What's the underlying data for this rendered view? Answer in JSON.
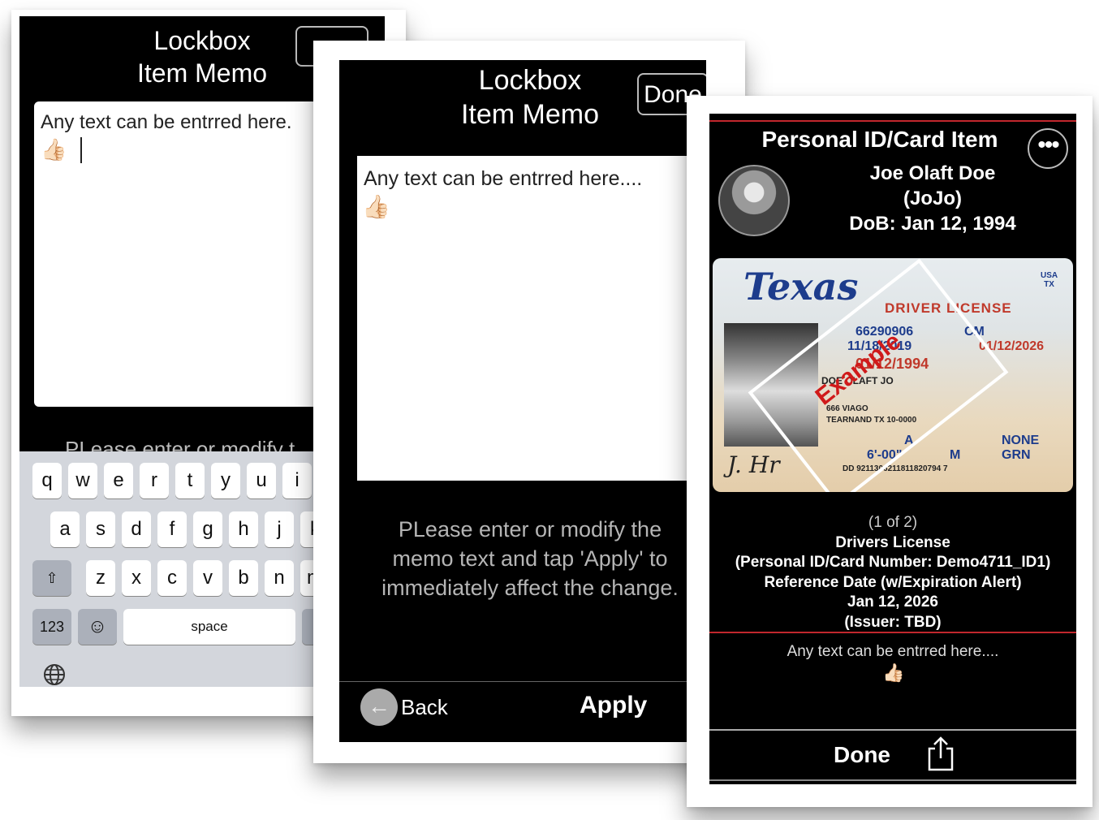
{
  "screen1": {
    "title_line1": "Lockbox",
    "title_line2": "Item Memo",
    "memo_text": "Any text can be entrred here.",
    "memo_emoji": "👍🏻",
    "hint_partial": "PLease enter or modify t",
    "keyboard": {
      "row1": [
        "q",
        "w",
        "e",
        "r",
        "t",
        "y",
        "u",
        "i"
      ],
      "row2": [
        "a",
        "s",
        "d",
        "f",
        "g",
        "h",
        "j",
        "k"
      ],
      "row3": [
        "z",
        "x",
        "c",
        "v",
        "b",
        "n",
        "m"
      ],
      "numbers_key": "123",
      "emoji_key": "☺",
      "space_key": "space",
      "shift_icon": "shift-icon",
      "globe_icon": "globe-icon"
    }
  },
  "screen2": {
    "title_line1": "Lockbox",
    "title_line2": "Item Memo",
    "done_label": "Done",
    "memo_text": "Any text can be entrred here....",
    "memo_emoji": "👍🏻",
    "hint": "PLease enter or modify the memo text and tap 'Apply' to immediately affect the change.",
    "back_label": "Back",
    "apply_label": "Apply"
  },
  "screen3": {
    "header_title": "Personal ID/Card  Item",
    "more_icon": "•••",
    "name": "Joe Olaft Doe",
    "nickname": "(JoJo)",
    "dob": "DoB: Jan 12, 1994",
    "id_card": {
      "state": "Texas",
      "country_line1": "USA",
      "country_line2": "TX",
      "title": "DRIVER LICENSE",
      "dl_number": "66290906",
      "iss": "11/18/2019",
      "exp": "01/12/2026",
      "dob": "01/12/1994",
      "class": "CM",
      "name": "DOE OLAFT JO",
      "address1": "666 VIAGO",
      "address2": "TEARNAND TX 10-0000",
      "restrictions": "A",
      "end": "NONE",
      "height": "6'-00\"",
      "sex": "M",
      "eyes": "GRN",
      "dd": "DD 9211306211811820794 7",
      "watermark": "Example",
      "signature": "J. Hr"
    },
    "count": "(1 of 2)",
    "card_type": "Drivers License",
    "card_number_line": "(Personal ID/Card Number: Demo4711_ID1)",
    "reference_label": "Reference Date (w/Expiration Alert)",
    "reference_date": "Jan 12, 2026",
    "issuer": "(Issuer: TBD)",
    "memo_text": "Any text can be entrred here....",
    "memo_emoji": "👍🏻",
    "done_label": "Done",
    "accent_red": "#c1272d"
  }
}
